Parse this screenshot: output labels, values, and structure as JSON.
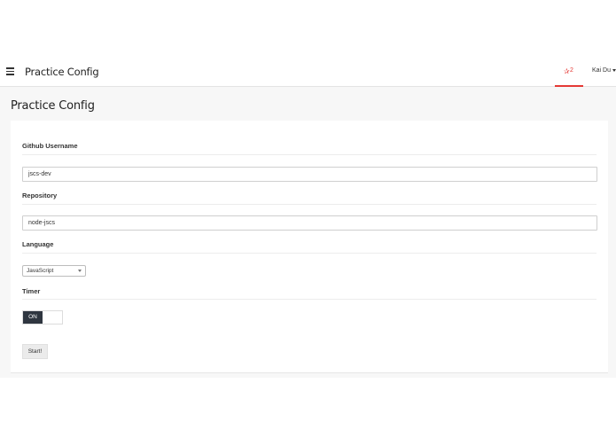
{
  "header": {
    "title": "Practice Config",
    "menu_icon": "hamburger-menu-icon",
    "star_icon": "star-icon",
    "star_glyph": "✰",
    "star_count": "2",
    "user_name": "Kai Du",
    "accent_color": "#e53935"
  },
  "page": {
    "title": "Practice Config"
  },
  "form": {
    "github_username_label": "Github Username",
    "github_username_value": "jscs-dev",
    "repository_label": "Repository",
    "repository_value": "node-jscs",
    "language_label": "Language",
    "language_selected": "JavaScript",
    "timer_label": "Timer",
    "timer_state": "ON",
    "start_label": "Start!"
  }
}
